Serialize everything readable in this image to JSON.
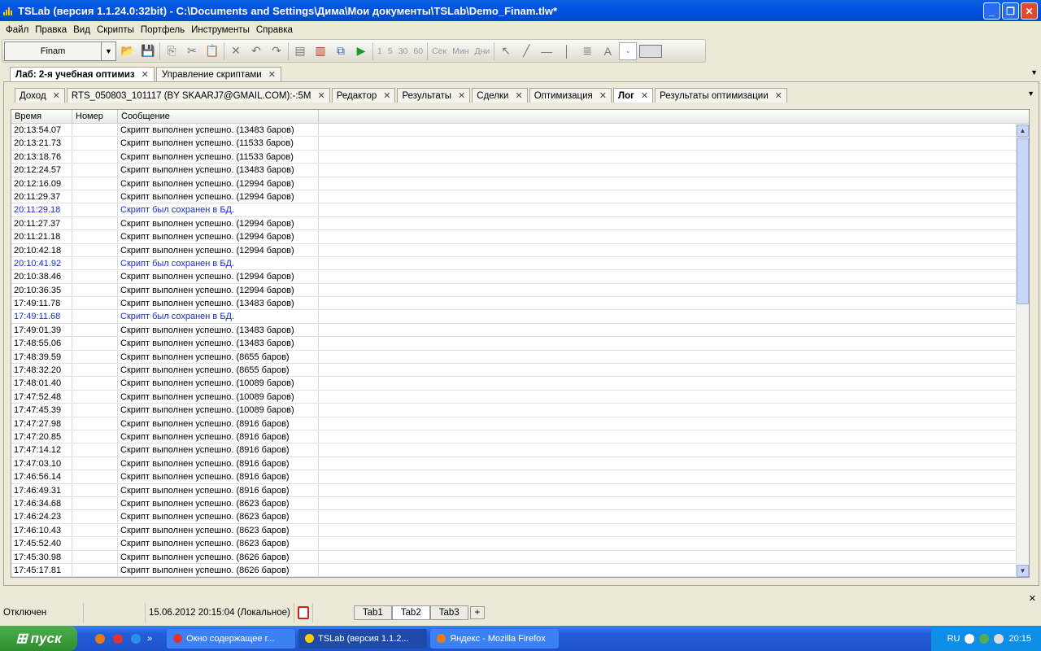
{
  "window": {
    "title": "TSLab (версия 1.1.24.0:32bit) - C:\\Documents and Settings\\Дима\\Мои документы\\TSLab\\Demo_Finam.tlw*"
  },
  "menu": [
    "Файл",
    "Правка",
    "Вид",
    "Скрипты",
    "Портфель",
    "Инструменты",
    "Справка"
  ],
  "toolbar": {
    "provider": "Finam",
    "intervals": [
      "1",
      "5",
      "30",
      "60"
    ],
    "units": [
      "Сек",
      "Мин",
      "Дни"
    ]
  },
  "doc_tabs": [
    "Лаб: 2-я учебная оптимиз",
    "Управление скриптами"
  ],
  "sub_tabs": [
    "Доход",
    "RTS_050803_101117 (BY SKAARJ7@GMAIL.COM):-:5M",
    "Редактор",
    "Результаты",
    "Сделки",
    "Оптимизация",
    "Лог",
    "Результаты оптимизации"
  ],
  "log": {
    "columns": [
      "Время",
      "Номер",
      "Сообщение"
    ],
    "rows": [
      {
        "time": "20:13:54.07",
        "msg": "Скрипт выполнен успешно. (13483 баров)"
      },
      {
        "time": "20:13:21.73",
        "msg": "Скрипт выполнен успешно. (11533 баров)"
      },
      {
        "time": "20:13:18.76",
        "msg": "Скрипт выполнен успешно. (11533 баров)"
      },
      {
        "time": "20:12:24.57",
        "msg": "Скрипт выполнен успешно. (13483 баров)"
      },
      {
        "time": "20:12:16.09",
        "msg": "Скрипт выполнен успешно. (12994 баров)"
      },
      {
        "time": "20:11:29.37",
        "msg": "Скрипт выполнен успешно. (12994 баров)"
      },
      {
        "time": "20:11:29.18",
        "msg": "Скрипт был сохранен в БД.",
        "saved": true
      },
      {
        "time": "20:11:27.37",
        "msg": "Скрипт выполнен успешно. (12994 баров)"
      },
      {
        "time": "20:11:21.18",
        "msg": "Скрипт выполнен успешно. (12994 баров)"
      },
      {
        "time": "20:10:42.18",
        "msg": "Скрипт выполнен успешно. (12994 баров)"
      },
      {
        "time": "20:10:41.92",
        "msg": "Скрипт был сохранен в БД.",
        "saved": true
      },
      {
        "time": "20:10:38.46",
        "msg": "Скрипт выполнен успешно. (12994 баров)"
      },
      {
        "time": "20:10:36.35",
        "msg": "Скрипт выполнен успешно. (12994 баров)"
      },
      {
        "time": "17:49:11.78",
        "msg": "Скрипт выполнен успешно. (13483 баров)"
      },
      {
        "time": "17:49:11.68",
        "msg": "Скрипт был сохранен в БД.",
        "saved": true
      },
      {
        "time": "17:49:01.39",
        "msg": "Скрипт выполнен успешно. (13483 баров)"
      },
      {
        "time": "17:48:55.06",
        "msg": "Скрипт выполнен успешно. (13483 баров)"
      },
      {
        "time": "17:48:39.59",
        "msg": "Скрипт выполнен успешно. (8655 баров)"
      },
      {
        "time": "17:48:32.20",
        "msg": "Скрипт выполнен успешно. (8655 баров)"
      },
      {
        "time": "17:48:01.40",
        "msg": "Скрипт выполнен успешно. (10089 баров)"
      },
      {
        "time": "17:47:52.48",
        "msg": "Скрипт выполнен успешно. (10089 баров)"
      },
      {
        "time": "17:47:45.39",
        "msg": "Скрипт выполнен успешно. (10089 баров)"
      },
      {
        "time": "17:47:27.98",
        "msg": "Скрипт выполнен успешно. (8916 баров)"
      },
      {
        "time": "17:47:20.85",
        "msg": "Скрипт выполнен успешно. (8916 баров)"
      },
      {
        "time": "17:47:14.12",
        "msg": "Скрипт выполнен успешно. (8916 баров)"
      },
      {
        "time": "17:47:03.10",
        "msg": "Скрипт выполнен успешно. (8916 баров)"
      },
      {
        "time": "17:46:56.14",
        "msg": "Скрипт выполнен успешно. (8916 баров)"
      },
      {
        "time": "17:46:49.31",
        "msg": "Скрипт выполнен успешно. (8916 баров)"
      },
      {
        "time": "17:46:34.68",
        "msg": "Скрипт выполнен успешно. (8623 баров)"
      },
      {
        "time": "17:46:24.23",
        "msg": "Скрипт выполнен успешно. (8623 баров)"
      },
      {
        "time": "17:46:10.43",
        "msg": "Скрипт выполнен успешно. (8623 баров)"
      },
      {
        "time": "17:45:52.40",
        "msg": "Скрипт выполнен успешно. (8623 баров)"
      },
      {
        "time": "17:45:30.98",
        "msg": "Скрипт выполнен успешно. (8626 баров)"
      },
      {
        "time": "17:45:17.81",
        "msg": "Скрипт выполнен успешно. (8626 баров)"
      }
    ]
  },
  "status": {
    "connection": "Отключен",
    "datetime": "15.06.2012 20:15:04 (Локальное)",
    "tabs": [
      "Tab1",
      "Tab2",
      "Tab3"
    ],
    "add": "+"
  },
  "taskbar": {
    "start": "пуск",
    "more": "»",
    "items": [
      "Окно содержащее г...",
      "TSLab (версия 1.1.2...",
      "Яндекс - Mozilla Firefox"
    ],
    "lang": "RU",
    "clock": "20:15"
  }
}
